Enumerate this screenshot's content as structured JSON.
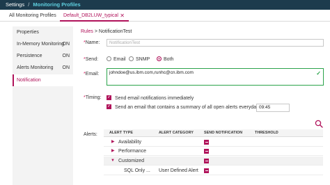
{
  "header": {
    "root": "Settings",
    "separator": "/",
    "current": "Monitoring Profiles"
  },
  "tabs": {
    "all_label": "All Monitoring Profiles",
    "active_label": "Default_DB2LUW_typical",
    "close_glyph": "✕"
  },
  "sidebar": {
    "items": [
      {
        "label": "Properties",
        "status": ""
      },
      {
        "label": "In-Memory Monitoring",
        "status": "ON"
      },
      {
        "label": "Persistence",
        "status": "ON"
      },
      {
        "label": "Alerts Monitoring",
        "status": "ON"
      },
      {
        "label": "Notification",
        "status": ""
      }
    ]
  },
  "breadcrumb": {
    "link": "Rules",
    "sep": ">",
    "current": "NotificationTest"
  },
  "form": {
    "req_marker": "*",
    "name_label": "Name:",
    "name_value": "NotificationTest",
    "send_label": "Send:",
    "send_options": [
      "Email",
      "SNMP",
      "Both"
    ],
    "send_selected": "Both",
    "email_label": "Email:",
    "email_value": "johndoe@us.ibm.com,runhc@cn.ibm.com",
    "timing_label": "Timing:",
    "timing_immediate": "Send email notifications immediately",
    "timing_summary": "Send an email that contains a summary of all open alerts everyday at:",
    "time_value": "09:45",
    "alerts_label": "Alerts:"
  },
  "alerts_table": {
    "headers": [
      "ALERT TYPE",
      "ALERT CATEGORY",
      "SEND NOTIFICATION",
      "THRESHOLD"
    ],
    "rows": [
      {
        "type": "Availability",
        "category": ""
      },
      {
        "type": "Performance",
        "category": ""
      },
      {
        "type": "Customized",
        "category": ""
      },
      {
        "type": "SQL Only ...",
        "category": "User Defined Alert"
      }
    ]
  },
  "colors": {
    "topbar": "#1d3b4d",
    "accent": "#b0125a",
    "valid": "#2aa34a"
  },
  "icons": {
    "search": "search-icon",
    "check": "check-icon"
  }
}
